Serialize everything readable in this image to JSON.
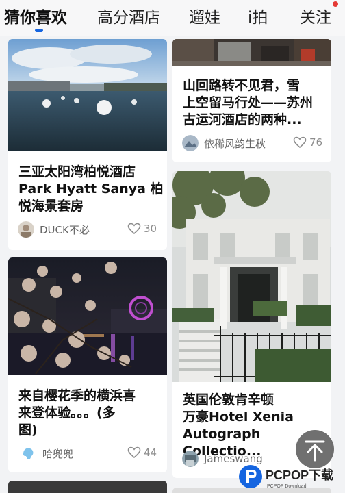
{
  "tabs": [
    {
      "label": "猜你喜欢"
    },
    {
      "label": "高分酒店"
    },
    {
      "label": "遛娃"
    },
    {
      "label": "i拍"
    },
    {
      "label": "关注"
    }
  ],
  "cards": [
    {
      "title": "三亚太阳湾柏悦酒店 Park Hyatt Sanya 柏悦海景套房",
      "title_lines": [
        "三亚太阳湾柏悦酒店",
        "Park Hyatt Sanya 柏",
        "悦海景套房"
      ],
      "author": "DUCK不必",
      "likes": "30"
    },
    {
      "title": "山回路转不见君，雪上空留马行处——苏州古运河酒店的两种...",
      "title_lines": [
        "山回路转不见君，雪",
        "上空留马行处——苏州",
        "古运河酒店的两种..."
      ],
      "author": "依稀风韵生秋",
      "likes": "76"
    },
    {
      "title": "来自樱花季的横浜喜来登体验。。。(多图)",
      "title_lines": [
        "来自樱花季的横浜喜",
        "来登体验。。。(多",
        "图)"
      ],
      "author": "哈兜兜",
      "likes": "44"
    },
    {
      "title": "英国伦敦肯辛顿万豪Hotel Xenia Autograph Collectio...",
      "title_lines": [
        "英国伦敦肯辛顿",
        "万豪Hotel Xenia",
        "Autograph Collectio..."
      ],
      "author": "Jameswang",
      "likes": ""
    }
  ],
  "watermark": {
    "brand": "PCPOP下载",
    "sub": "PCPOP Download"
  },
  "colors": {
    "accent": "#1565e0",
    "badge": "#e53935"
  }
}
